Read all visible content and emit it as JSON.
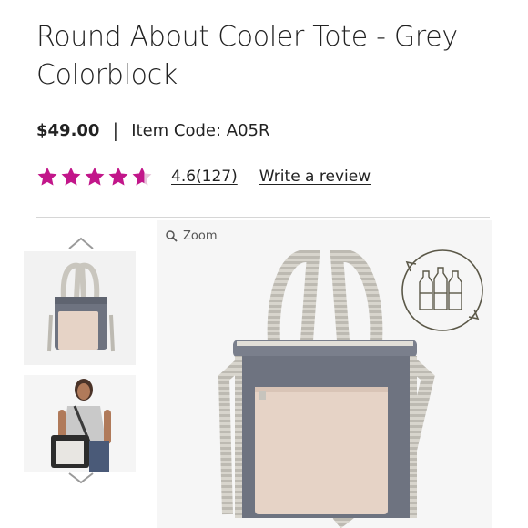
{
  "product": {
    "title": "Round About Cooler Tote - Grey Colorblock",
    "price": "$49.00",
    "separator": "|",
    "item_code": "Item Code: A05R",
    "rating": {
      "value": "4.6",
      "count": "(127)",
      "stars": 4.6,
      "write_review": "Write a review"
    }
  },
  "gallery": {
    "zoom_label": "Zoom"
  },
  "colors": {
    "star": "#c2168a",
    "grey": "#6e7380",
    "tan": "#e6d3c6",
    "stripe": "#cfccc4",
    "badge": "#5b5848"
  }
}
